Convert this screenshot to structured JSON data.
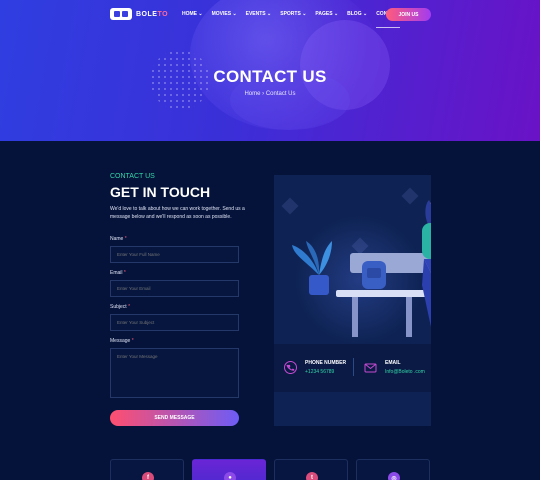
{
  "brand": {
    "name_part1": "BOLE",
    "name_part2": "TO"
  },
  "nav": {
    "items": [
      "HOME",
      "MOVIES",
      "EVENTS",
      "SPORTS",
      "PAGES",
      "BLOG",
      "CONTACT"
    ],
    "chevron": "⌄",
    "join_label": "JOIN US"
  },
  "hero": {
    "title": "CONTACT US",
    "breadcrumb": {
      "home": "Home",
      "separator": "›",
      "current": "Contact Us"
    }
  },
  "contact": {
    "eyebrow": "CONTACT US",
    "heading": "GET IN TOUCH",
    "intro": "We'd love to talk about how we can work together. Send us a message below and we'll respond as soon as possible.",
    "form": {
      "name_label": "Name",
      "name_placeholder": "Enter Your Full Name",
      "email_label": "Email",
      "email_placeholder": "Enter Your Email",
      "subject_label": "Subject",
      "subject_placeholder": "Enter Your Subject",
      "message_label": "Message",
      "message_placeholder": "Enter Your Message",
      "required_mark": "*",
      "send_label": "SEND MESSAGE"
    },
    "info": {
      "phone_title": "PHONE NUMBER",
      "phone_value": "+1234 56789",
      "email_title": "EMAIL",
      "email_value": "Info@Boleto .com"
    }
  },
  "social": [
    {
      "icon": "facebook-icon",
      "glyph": "f",
      "color": "#d94b7a"
    },
    {
      "icon": "group-icon",
      "glyph": "●",
      "color": "#8c4be8"
    },
    {
      "icon": "twitter-icon",
      "glyph": "t",
      "color": "#d94b7a"
    },
    {
      "icon": "instagram-icon",
      "glyph": "◎",
      "color": "#8c4be8"
    }
  ],
  "colors": {
    "accent_green": "#34d6a8",
    "accent_pink": "#ff5b7b",
    "background": "#05133a",
    "hero_start": "#2f3ee0",
    "hero_end": "#6a12c6"
  }
}
